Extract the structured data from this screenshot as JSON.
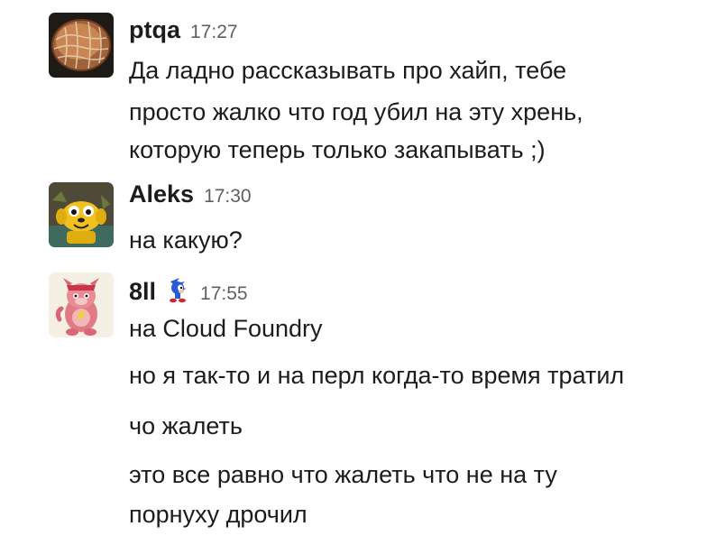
{
  "messages": [
    {
      "author": "ptqa",
      "time": "17:27",
      "avatar_icon": "dried-sponge-gourd-avatar",
      "lines": [
        "Да ладно рассказывать про хайп, тебе",
        "просто жалко что год убил на эту хрень,",
        "которую теперь только закапывать ;)"
      ]
    },
    {
      "author": "Aleks",
      "time": "17:30",
      "avatar_icon": "yellow-dog-cartoon-avatar",
      "lines": [
        "на какую?"
      ]
    },
    {
      "author": "8ll",
      "time": "17:55",
      "avatar_icon": "pink-cartoon-creature-avatar",
      "status_icon": "blue-hedgehog-status-icon",
      "lines": [
        "на Cloud Foundry",
        "но я так-то и на перл когда-то время тратил",
        "чо жалеть",
        "это все равно что жалеть что не на ту",
        "порнуху дрочил"
      ]
    }
  ]
}
